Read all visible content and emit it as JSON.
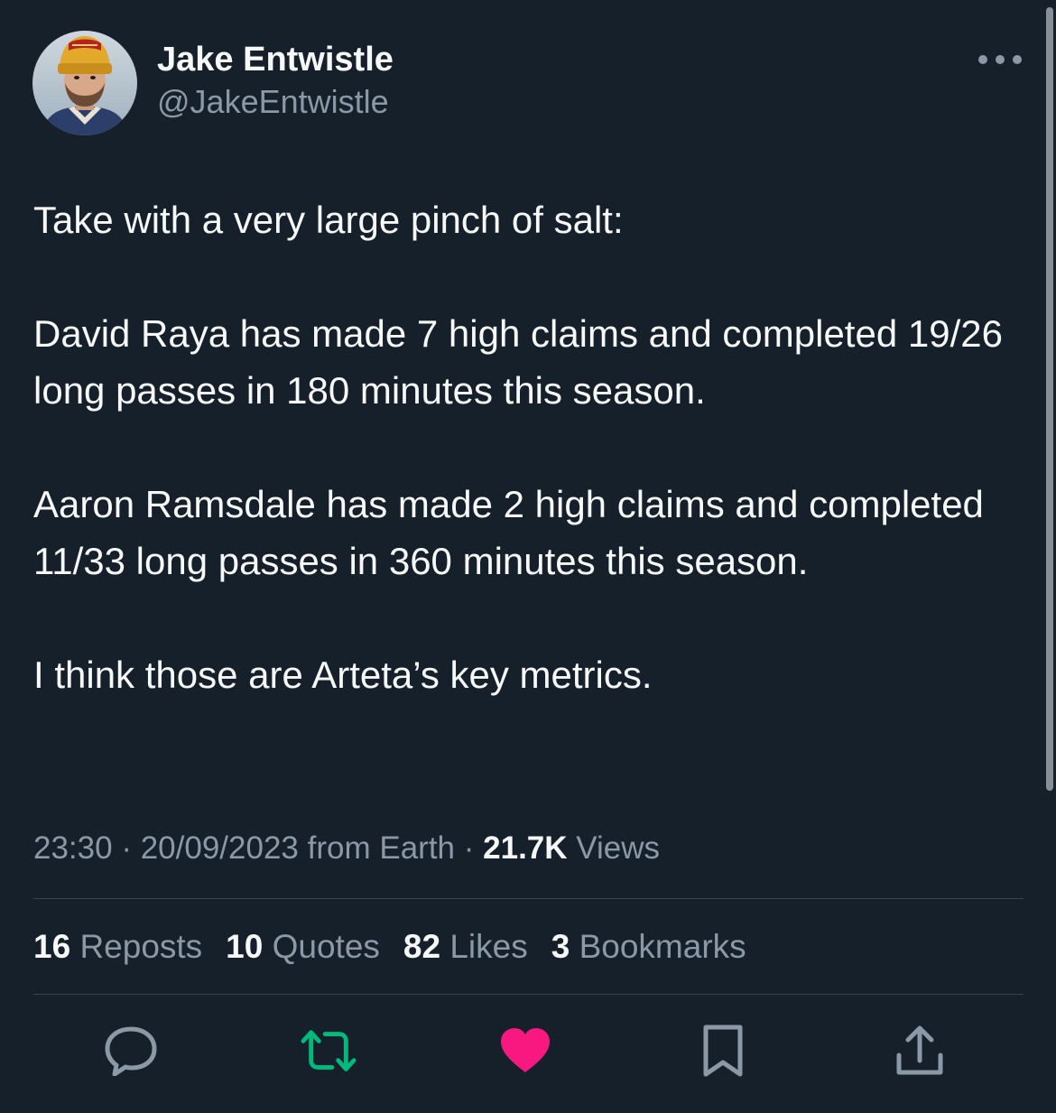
{
  "user": {
    "display_name": "Jake Entwistle",
    "handle": "@JakeEntwistle"
  },
  "tweet": {
    "paragraphs": [
      "Take with a very large pinch of salt:",
      "David Raya has made 7 high claims and completed 19/26 long passes in 180 minutes this season.",
      "Aaron Ramsdale has made 2 high claims and completed 11/33 long passes in 360 minutes this season.",
      "I think those are Arteta’s key metrics."
    ]
  },
  "meta": {
    "time": "23:30",
    "date": "20/09/2023",
    "source": "from Earth",
    "separator": "·",
    "views_count": "21.7K",
    "views_label": "Views"
  },
  "stats": [
    {
      "count": "16",
      "label": "Reposts"
    },
    {
      "count": "10",
      "label": "Quotes"
    },
    {
      "count": "82",
      "label": "Likes"
    },
    {
      "count": "3",
      "label": "Bookmarks"
    }
  ],
  "actions": [
    {
      "icon": "reply-icon"
    },
    {
      "icon": "repost-icon",
      "color": "#00ba7c"
    },
    {
      "icon": "like-icon",
      "color": "#f91880",
      "active": true
    },
    {
      "icon": "bookmark-icon"
    },
    {
      "icon": "share-icon"
    }
  ],
  "colors": {
    "background": "#15202b",
    "text_primary": "#f7f9f9",
    "text_secondary": "#8b98a5",
    "divider": "#38444d",
    "repost": "#00ba7c",
    "like": "#f91880"
  }
}
